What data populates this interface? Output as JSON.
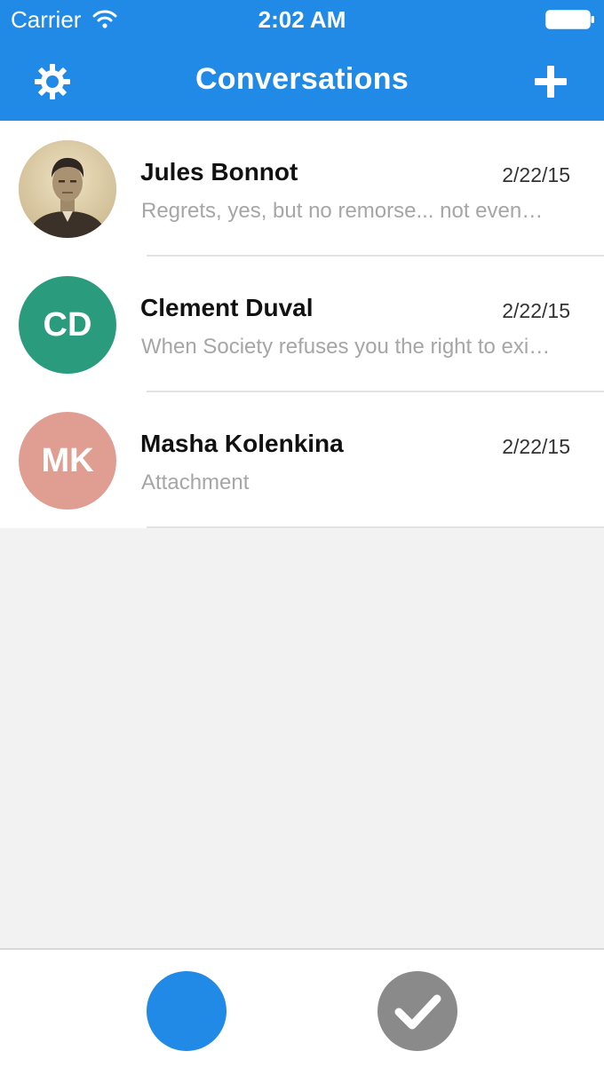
{
  "status_bar": {
    "carrier": "Carrier",
    "time": "2:02 AM",
    "wifi_icon": "wifi-icon",
    "battery_icon": "battery-icon"
  },
  "nav": {
    "title": "Conversations",
    "settings_icon": "gear-icon",
    "add_icon": "plus-icon"
  },
  "conversations": [
    {
      "name": "Jules Bonnot",
      "date": "2/22/15",
      "preview": "Regrets, yes, but no remorse... not even…",
      "avatar_type": "photo",
      "avatar_color": "#d8c69e"
    },
    {
      "name": "Clement Duval",
      "date": "2/22/15",
      "preview": "When Society refuses you the right to exi…",
      "avatar_type": "initials",
      "initials": "CD",
      "avatar_color": "#2a9c7d"
    },
    {
      "name": "Masha Kolenkina",
      "date": "2/22/15",
      "preview": "Attachment",
      "avatar_type": "initials",
      "initials": "MK",
      "avatar_color": "#e09e92"
    }
  ],
  "tab_bar": {
    "conversations_tab_color": "#2189e6",
    "done_tab_color": "#8a8a8a",
    "done_icon": "checkmark-icon"
  },
  "colors": {
    "accent": "#2189e6",
    "background": "#f2f2f2",
    "preview_text": "#a6a6a6"
  }
}
